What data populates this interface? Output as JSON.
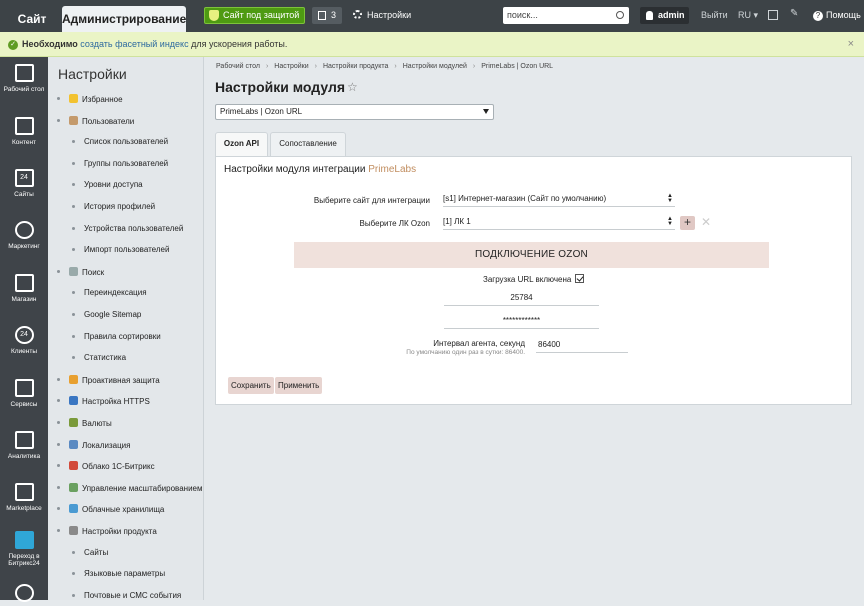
{
  "topbar": {
    "site_tab": "Сайт",
    "admin_tab": "Администрирование",
    "protection": "Сайт под защитой",
    "notif_count": "3",
    "settings": "Настройки",
    "search_placeholder": "поиск...",
    "user": "admin",
    "logout": "Выйти",
    "lang": "RU",
    "help": "Помощь"
  },
  "alert": {
    "bold": "Необходимо",
    "link": "создать фасетный индекс",
    "rest": "для ускорения работы.",
    "close": "×"
  },
  "sidebar": [
    {
      "label": "Рабочий стол",
      "icon": "home-icon"
    },
    {
      "label": "Контент",
      "icon": "content-icon"
    },
    {
      "label": "Сайты",
      "icon": "calendar-icon",
      "num": "24"
    },
    {
      "label": "Маркетинг",
      "icon": "target-icon"
    },
    {
      "label": "Магазин",
      "icon": "basket-icon"
    },
    {
      "label": "Клиенты",
      "icon": "clients-icon",
      "num": "24"
    },
    {
      "label": "Сервисы",
      "icon": "layers-icon"
    },
    {
      "label": "Аналитика",
      "icon": "chart-icon"
    },
    {
      "label": "Marketplace",
      "icon": "cloud-icon"
    },
    {
      "label": "Переход в Битрикс24",
      "icon": "b24-icon"
    },
    {
      "label": "",
      "icon": "gear-icon"
    }
  ],
  "menu": {
    "title": "Настройки",
    "items": [
      {
        "label": "Избранное",
        "level": 1
      },
      {
        "label": "Пользователи",
        "level": 1
      },
      {
        "label": "Список пользователей",
        "level": 2
      },
      {
        "label": "Группы пользователей",
        "level": 2
      },
      {
        "label": "Уровни доступа",
        "level": 2
      },
      {
        "label": "История профилей",
        "level": 2
      },
      {
        "label": "Устройства пользователей",
        "level": 2
      },
      {
        "label": "Импорт пользователей",
        "level": 2
      },
      {
        "label": "Поиск",
        "level": 1
      },
      {
        "label": "Переиндексация",
        "level": 2
      },
      {
        "label": "Google Sitemap",
        "level": 2
      },
      {
        "label": "Правила сортировки",
        "level": 2
      },
      {
        "label": "Статистика",
        "level": 2
      },
      {
        "label": "Проактивная защита",
        "level": 1
      },
      {
        "label": "Настройка HTTPS",
        "level": 1
      },
      {
        "label": "Валюты",
        "level": 1
      },
      {
        "label": "Локализация",
        "level": 1
      },
      {
        "label": "Облако 1С-Битрикс",
        "level": 1
      },
      {
        "label": "Управление масштабированием",
        "level": 1
      },
      {
        "label": "Облачные хранилища",
        "level": 1
      },
      {
        "label": "Настройки продукта",
        "level": 1
      },
      {
        "label": "Сайты",
        "level": 2
      },
      {
        "label": "Языковые параметры",
        "level": 2
      },
      {
        "label": "Почтовые и СМС события",
        "level": 2
      }
    ]
  },
  "breadcrumbs": [
    "Рабочий стол",
    "Настройки",
    "Настройки продукта",
    "Настройки модулей",
    "PrimeLabs | Ozon URL"
  ],
  "page_title": "Настройки модуля",
  "module_select": "PrimeLabs | Ozon URL",
  "tabs": [
    "Ozon API",
    "Сопоставление"
  ],
  "panel": {
    "title": "Настройки модуля интеграции",
    "brand": "PrimeLabs",
    "site_label": "Выберите сайт для интеграции",
    "site_value": "[s1] Интернет-магазин (Сайт по умолчанию)",
    "lk_label": "Выберите ЛК Ozon",
    "lk_value": "[1] ЛК 1",
    "ozon_header": "ПОДКЛЮЧЕНИЕ OZON",
    "url_load": "Загрузка URL включена",
    "client_id": "25784",
    "api_key": "************",
    "interval_label": "Интервал агента, секунд",
    "interval_hint": "По умолчанию один раз в сутки: 86400.",
    "interval_value": "86400",
    "save": "Сохранить",
    "apply": "Применить"
  }
}
